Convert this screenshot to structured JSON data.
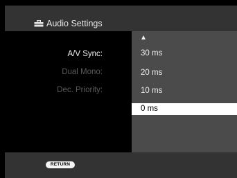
{
  "header": {
    "title": "Audio Settings",
    "icon": "toolbox-icon"
  },
  "settings": {
    "items": [
      {
        "label": "A/V Sync:",
        "state": "active"
      },
      {
        "label": "Dual Mono:",
        "state": "disabled"
      },
      {
        "label": "Dec. Priority:",
        "state": "disabled"
      }
    ]
  },
  "dropdown": {
    "scroll_up_icon": "triangle-up-icon",
    "options": [
      "30 ms",
      "20 ms",
      "10 ms",
      "0 ms"
    ],
    "selected": "0 ms"
  },
  "footer": {
    "return_label": "RETURN"
  },
  "colors": {
    "background": "#000000",
    "bar": "#333333",
    "dropdown_bg": "#4b4b4b",
    "selected_bg": "#ffffff",
    "disabled_text": "#5a5a5a"
  }
}
